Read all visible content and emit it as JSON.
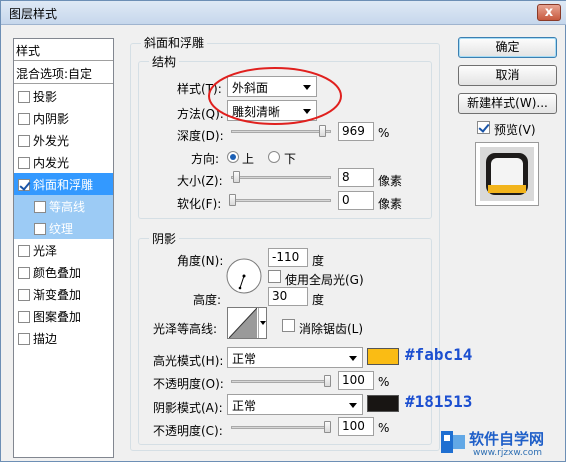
{
  "window": {
    "title": "图层样式",
    "close_symbol": "x"
  },
  "styles_panel": {
    "header": "样式",
    "blend_options": "混合选项:自定",
    "items": [
      {
        "label": "投影",
        "checked": false
      },
      {
        "label": "内阴影",
        "checked": false
      },
      {
        "label": "外发光",
        "checked": false
      },
      {
        "label": "内发光",
        "checked": false
      },
      {
        "label": "斜面和浮雕",
        "checked": true,
        "selected": true
      },
      {
        "label": "等高线",
        "checked": false,
        "sub": true
      },
      {
        "label": "纹理",
        "checked": false,
        "sub": true
      },
      {
        "label": "光泽",
        "checked": false
      },
      {
        "label": "颜色叠加",
        "checked": false
      },
      {
        "label": "渐变叠加",
        "checked": false
      },
      {
        "label": "图案叠加",
        "checked": false
      },
      {
        "label": "描边",
        "checked": false
      }
    ]
  },
  "bevel": {
    "group_title": "斜面和浮雕",
    "structure": {
      "title": "结构",
      "style_label": "样式(T):",
      "style_value": "外斜面",
      "technique_label": "方法(Q):",
      "technique_value": "雕刻清晰",
      "depth_label": "深度(D):",
      "depth_value": "969",
      "depth_unit": "%",
      "depth_slider": 0.95,
      "direction_label": "方向:",
      "direction_up": "上",
      "direction_down": "下",
      "direction_selected": "上",
      "size_label": "大小(Z):",
      "size_value": "8",
      "size_unit": "像素",
      "size_slider": 0.04,
      "soften_label": "软化(F):",
      "soften_value": "0",
      "soften_unit": "像素",
      "soften_slider": 0.0
    },
    "shading": {
      "title": "阴影",
      "angle_label": "角度(N):",
      "angle_value": "-110",
      "angle_unit": "度",
      "global_light_label": "使用全局光(G)",
      "global_light_checked": false,
      "altitude_label": "高度:",
      "altitude_value": "30",
      "altitude_unit": "度",
      "gloss_contour_label": "光泽等高线:",
      "antialias_label": "消除锯齿(L)",
      "antialias_checked": false,
      "highlight_mode_label": "高光模式(H):",
      "highlight_mode_value": "正常",
      "highlight_color": "#fabc14",
      "highlight_note": "#fabc14",
      "highlight_opacity_label": "不透明度(O):",
      "highlight_opacity_value": "100",
      "highlight_opacity_unit": "%",
      "highlight_opacity_slider": 1.0,
      "shadow_mode_label": "阴影模式(A):",
      "shadow_mode_value": "正常",
      "shadow_color": "#181513",
      "shadow_note": "#181513",
      "shadow_opacity_label": "不透明度(C):",
      "shadow_opacity_value": "100",
      "shadow_opacity_unit": "%",
      "shadow_opacity_slider": 1.0
    }
  },
  "buttons": {
    "ok": "确定",
    "cancel": "取消",
    "new_style": "新建样式(W)...",
    "preview_label": "预览(V)",
    "preview_checked": true
  },
  "watermark": {
    "brand": "软件自学网",
    "url": "www.rjzxw.com"
  },
  "colors": {
    "accent": "#3399ff",
    "annotation": "#1c4fd0",
    "circle": "#e0201e"
  }
}
